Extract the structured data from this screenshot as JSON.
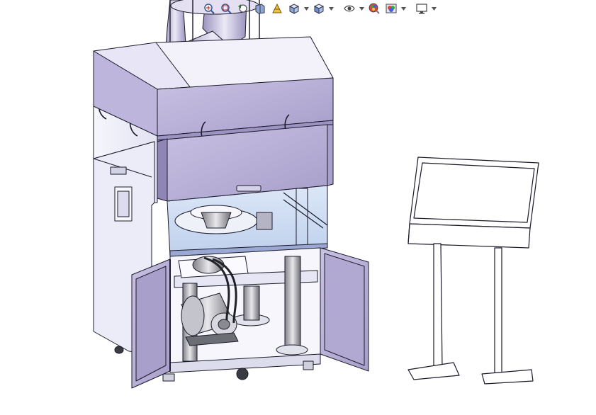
{
  "app": {
    "window_title": ""
  },
  "hud_toolbar": {
    "buttons": [
      {
        "icon": "zoom-to-fit-icon"
      },
      {
        "icon": "zoom-to-area-icon"
      },
      {
        "icon": "previous-view-icon"
      },
      {
        "icon": "section-view-icon"
      },
      {
        "icon": "dynamic-annotation-icon"
      },
      {
        "icon": "view-orientation-icon",
        "has_menu": true
      },
      {
        "icon": "display-style-icon",
        "has_menu": true
      },
      {
        "icon": "hide-show-items-icon",
        "has_menu": true
      },
      {
        "icon": "edit-appearance-icon"
      },
      {
        "icon": "apply-scene-icon",
        "has_menu": true
      },
      {
        "icon": "view-settings-icon",
        "has_menu": true
      }
    ]
  },
  "colors": {
    "part_purple": "#b9b1d6",
    "part_purple_dark": "#8f86b5",
    "panel_light": "#eeeef9",
    "glass_blue": "#c9d9f2",
    "edge": "#1a1a2a",
    "background": "#ffffff"
  },
  "model": {
    "components": [
      "tablet-press-machine",
      "touch-screen-stand"
    ]
  }
}
